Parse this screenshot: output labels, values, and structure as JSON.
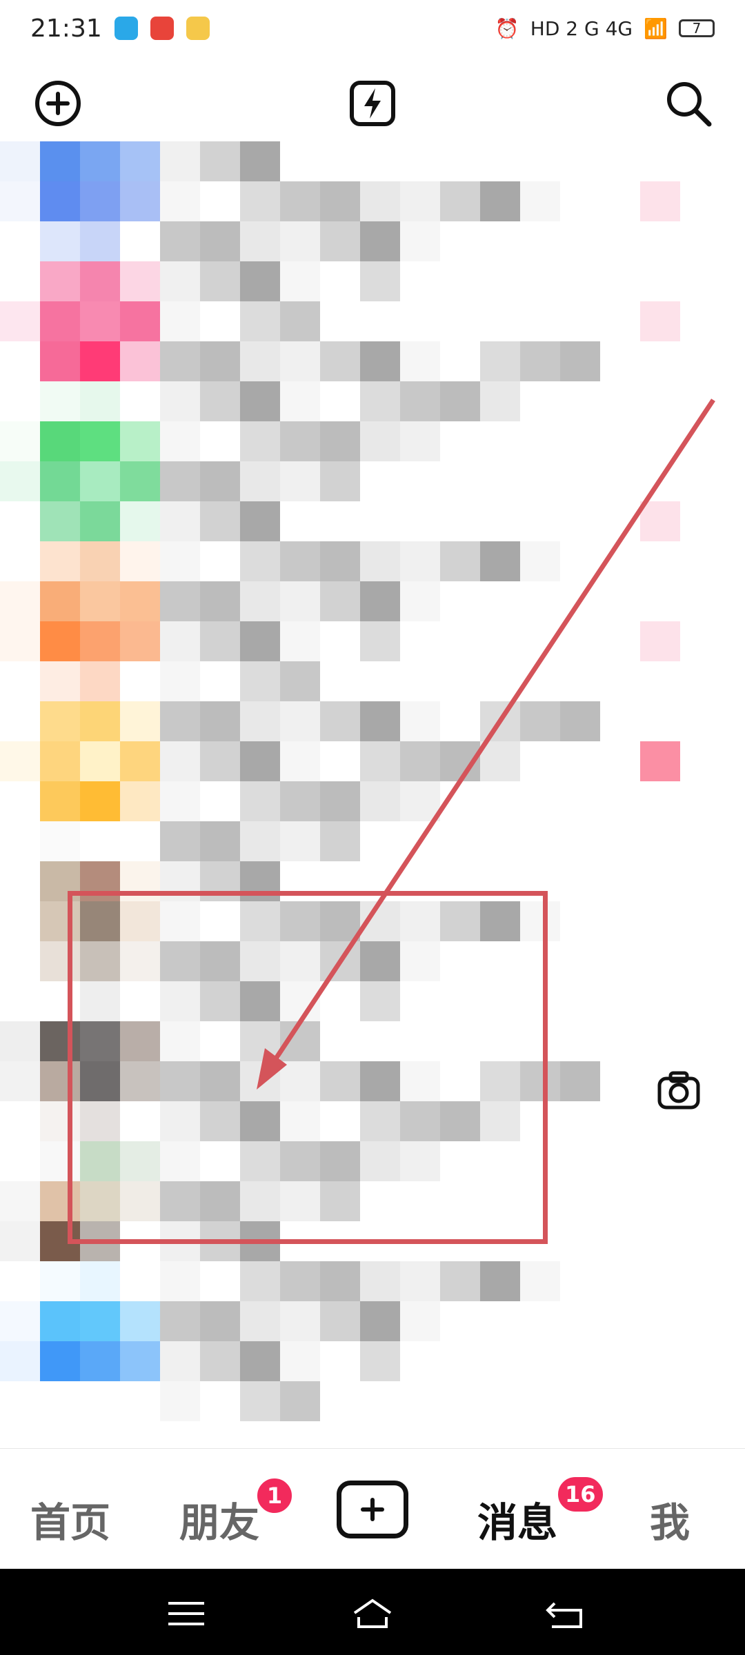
{
  "status_bar": {
    "time": "21:31",
    "network": "HD 2  G  4G",
    "battery": "7"
  },
  "top_bar": {
    "add_icon": "plus-circle-icon",
    "flash_icon": "lightning-icon",
    "search_icon": "search-icon"
  },
  "tabs": [
    {
      "label": "首页"
    },
    {
      "label": "朋友",
      "badge": "1"
    },
    {
      "label": "消息",
      "badge": "16"
    },
    {
      "label": "我"
    }
  ],
  "colors": {
    "accent_red": "#d4545a",
    "badge": "#f22a5c"
  }
}
